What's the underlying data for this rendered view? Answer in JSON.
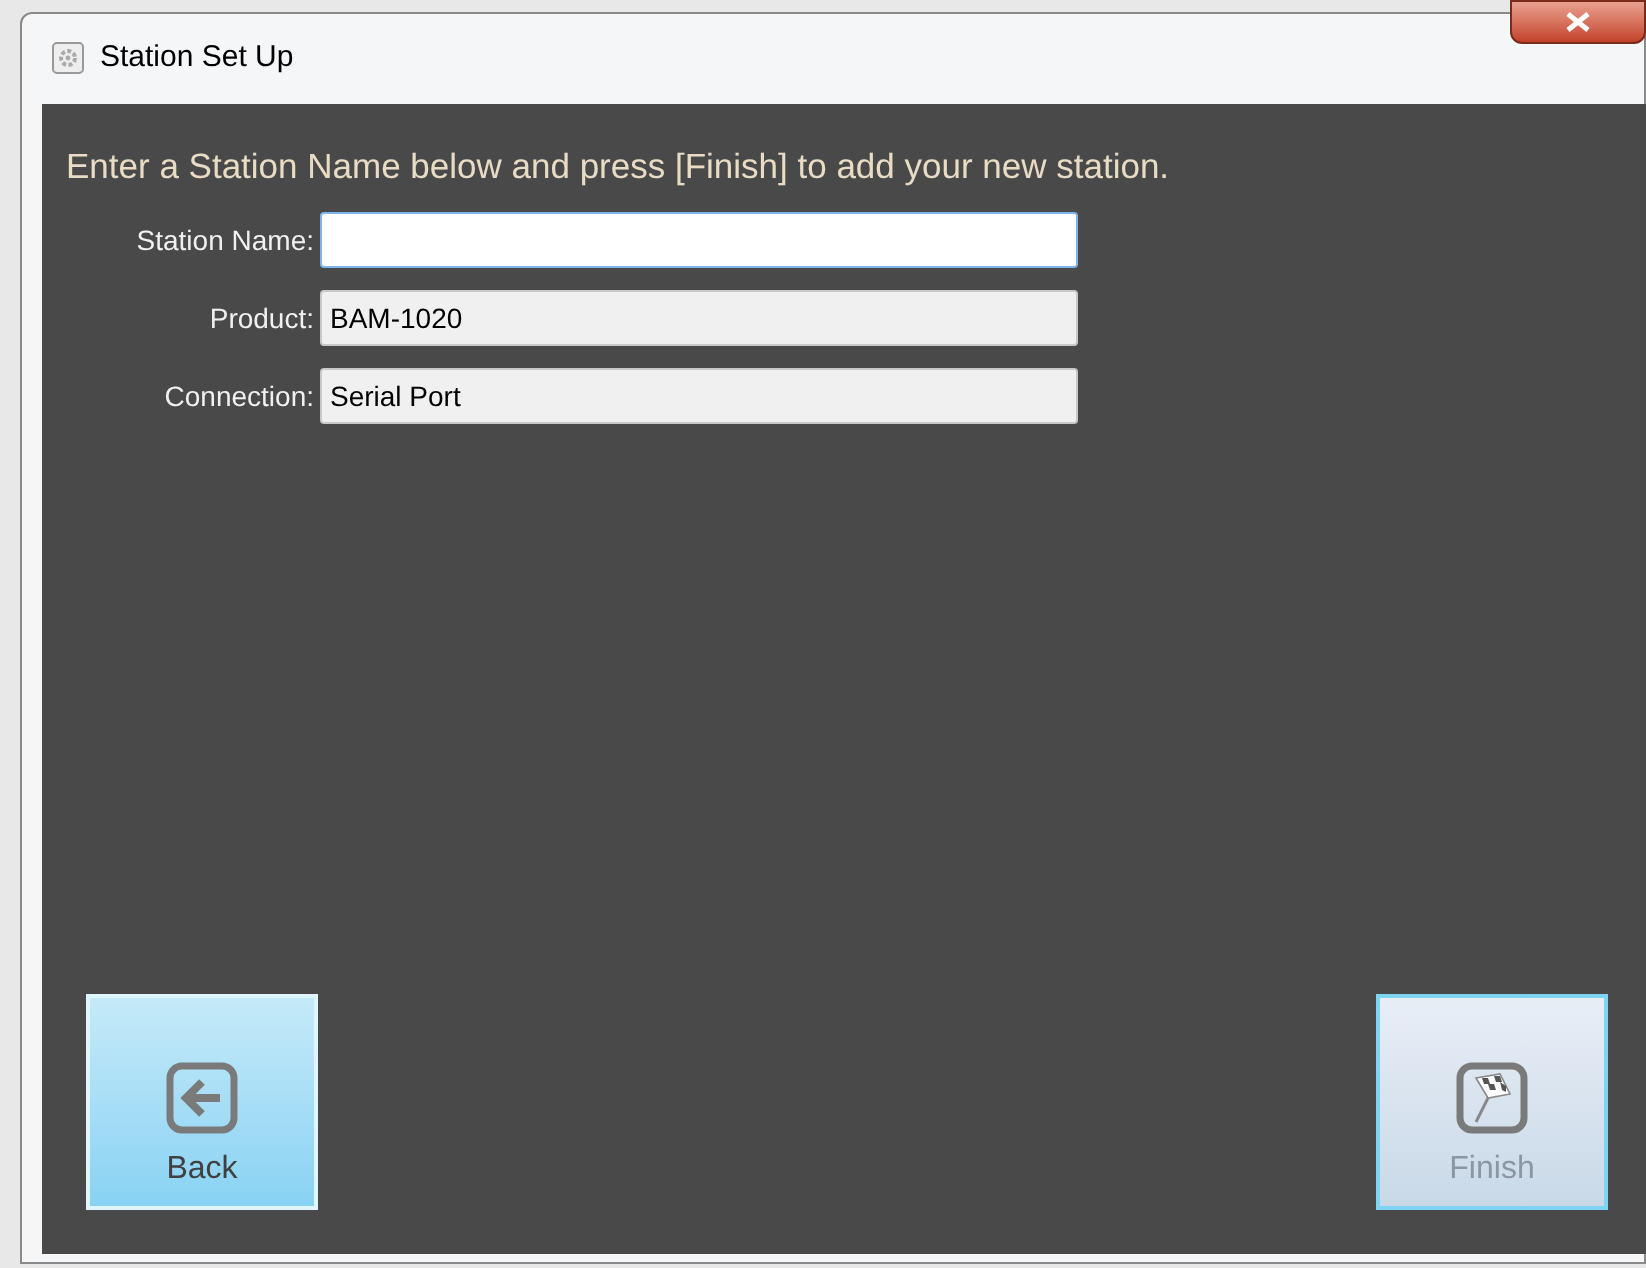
{
  "window": {
    "title": "Station Set Up"
  },
  "instruction": "Enter a Station Name below and press [Finish] to add your new station.",
  "fields": [
    {
      "label": "Station Name:",
      "read_only": false
    },
    {
      "label": "Product:",
      "value": "BAM-1020",
      "read_only": true
    },
    {
      "label": "Connection:",
      "value": "Serial Port",
      "read_only": true
    }
  ],
  "buttons": [
    {
      "label": "Back",
      "kind": "back",
      "disabled": false
    },
    {
      "label": "Finish",
      "kind": "finish",
      "disabled": true
    }
  ]
}
